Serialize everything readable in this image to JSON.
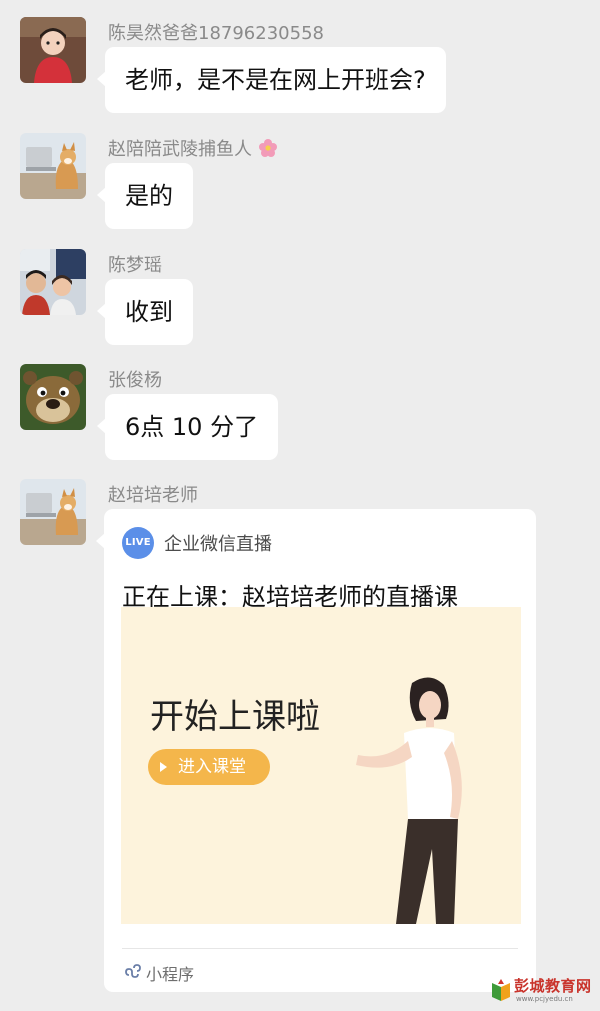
{
  "messages": [
    {
      "sender": "陈昊然爸爸18796230558",
      "text": "老师，是不是在网上开班会?"
    },
    {
      "sender": "赵陪陪武陵捕鱼人",
      "text": "是的"
    },
    {
      "sender": "陈梦瑶",
      "text": "收到"
    },
    {
      "sender": "张俊杨",
      "text": "6点 10 分了"
    },
    {
      "sender": "赵培培老师"
    }
  ],
  "live_card": {
    "badge": "LIVE",
    "app_name": "企业微信直播",
    "title": "正在上课：赵培培老师的直播课",
    "headline": "开始上课啦",
    "button_label": "进入课堂",
    "footer_label": "小程序"
  },
  "watermark": {
    "text": "彭城教育网",
    "url": "www.pcjyedu.cn"
  },
  "colors": {
    "background": "#ededed",
    "bubble": "#ffffff",
    "live_badge": "#5b8fe8",
    "button": "#f4b64b",
    "card_image_bg": "#fdf3dc"
  }
}
